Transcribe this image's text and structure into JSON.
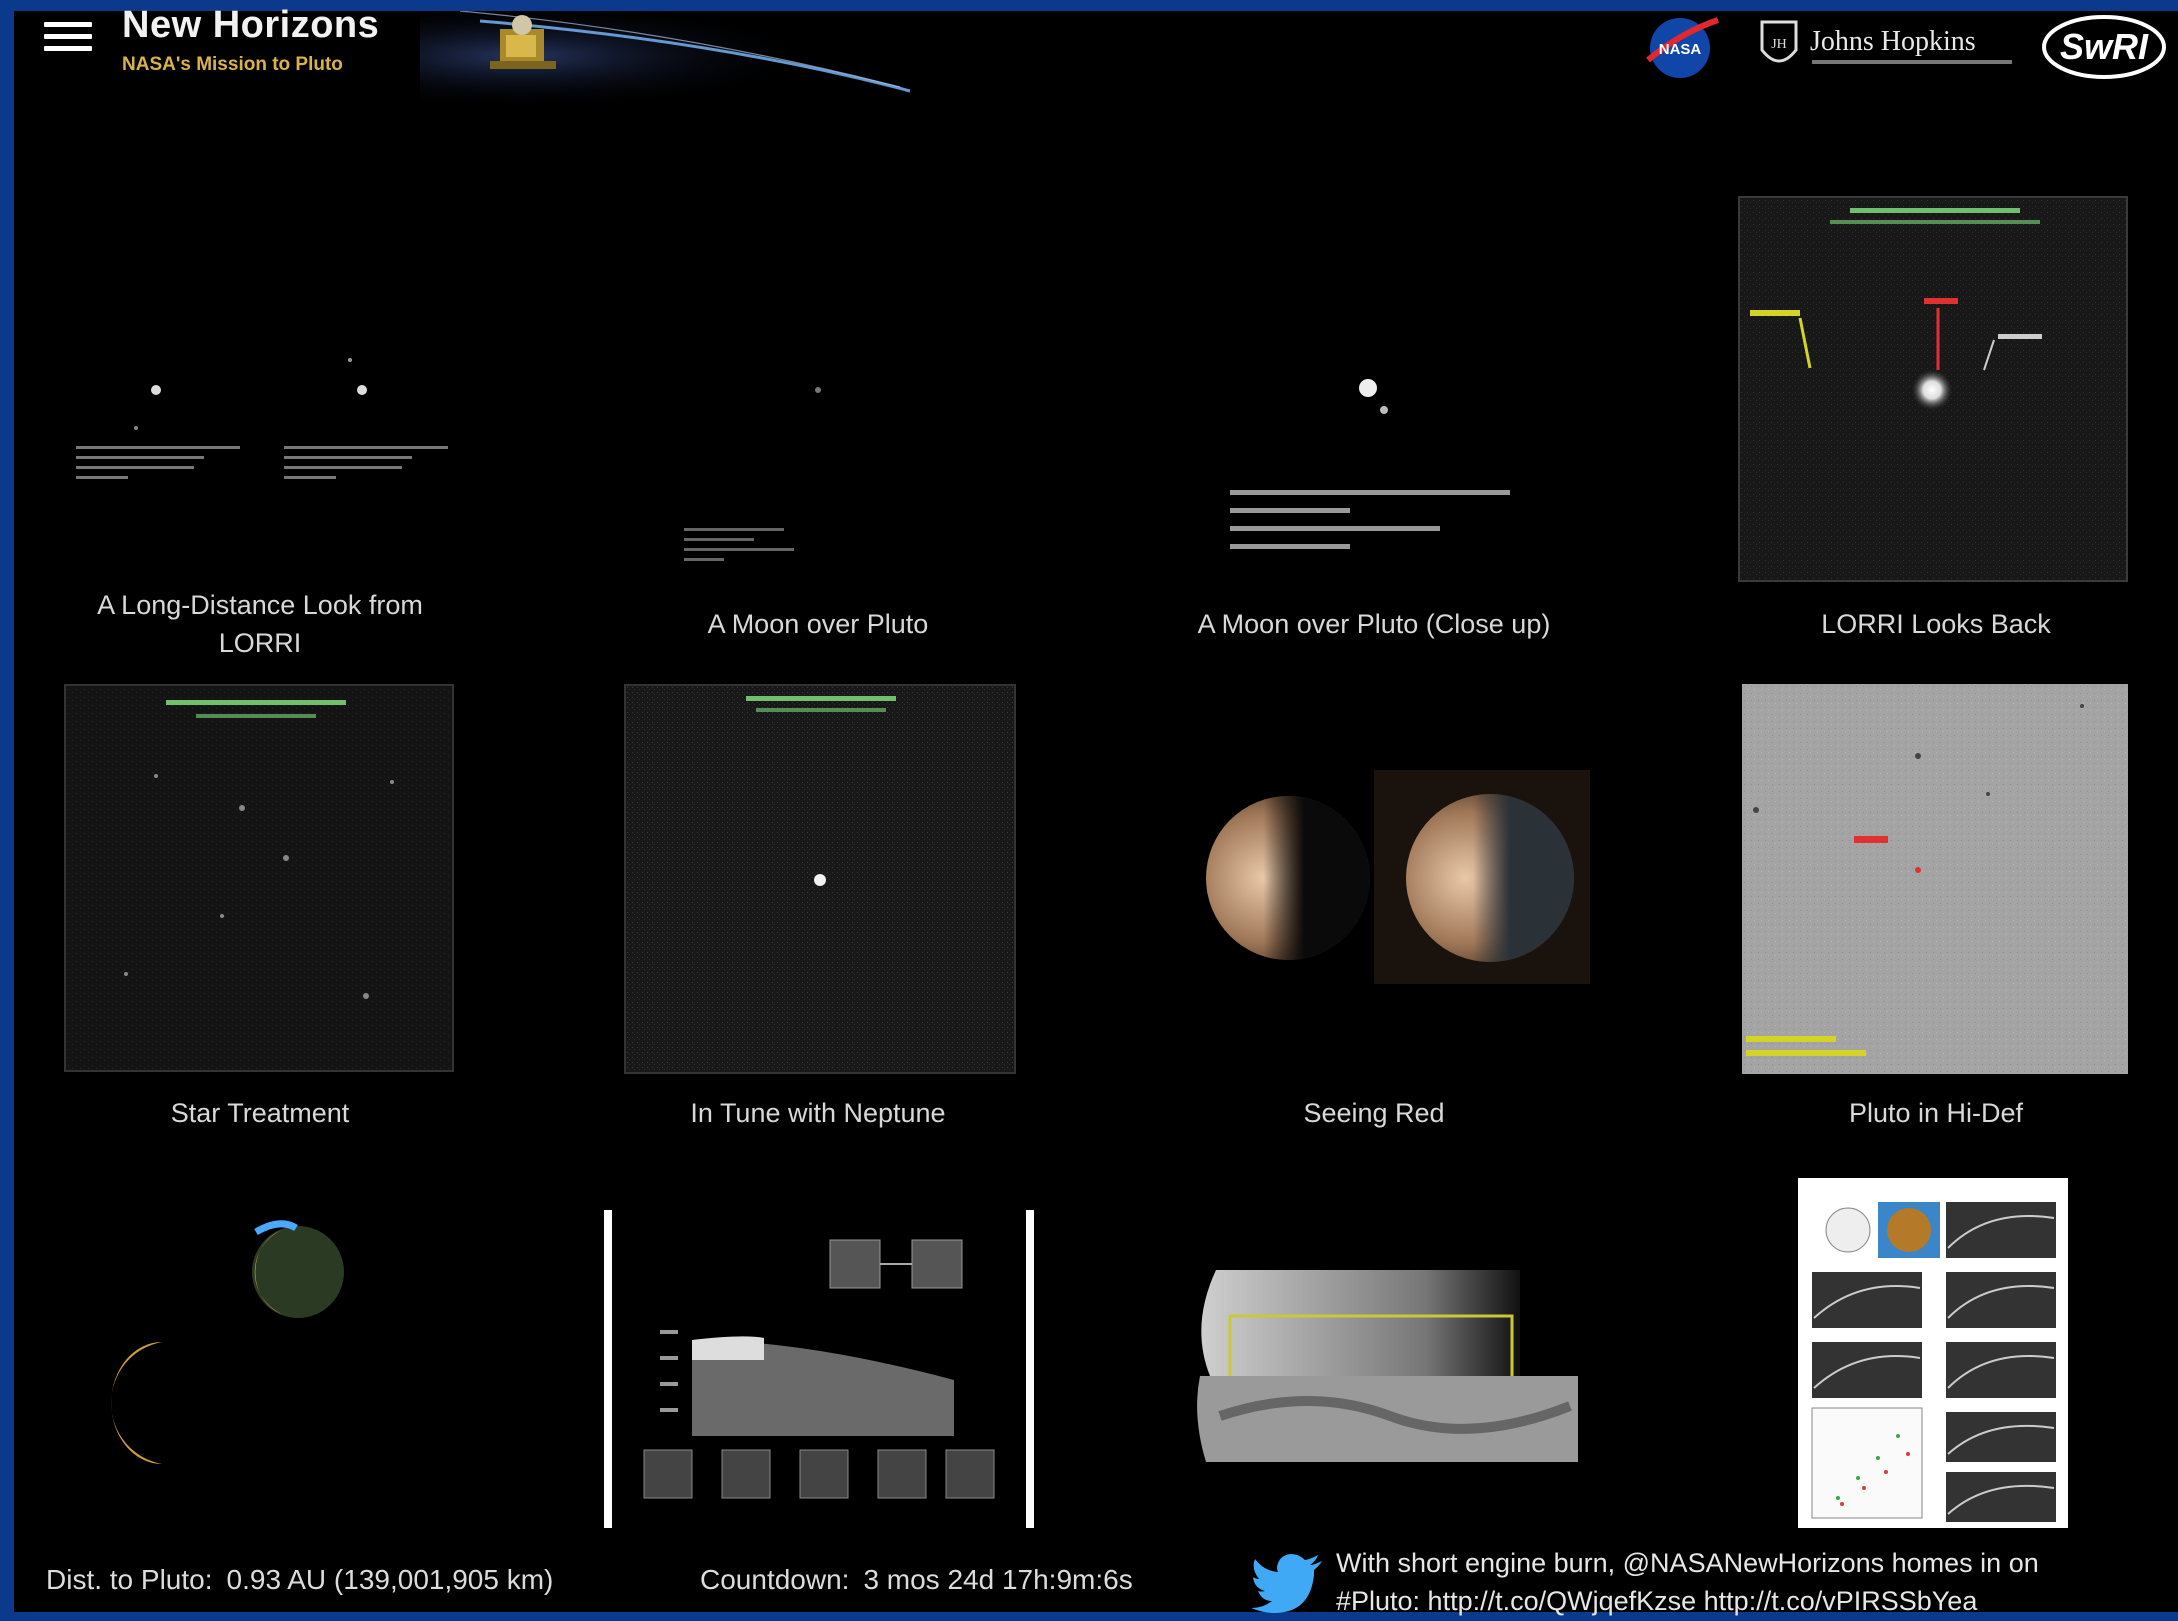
{
  "header": {
    "title": "New Horizons",
    "subtitle": "NASA's Mission to Pluto",
    "logos": [
      "NASA",
      "Johns Hopkins",
      "SwRI"
    ]
  },
  "gallery": {
    "items": [
      {
        "caption": "A Long-Distance Look from LORRI"
      },
      {
        "caption": "A Moon over Pluto"
      },
      {
        "caption": "A Moon over Pluto (Close up)"
      },
      {
        "caption": "LORRI Looks Back"
      },
      {
        "caption": "Star Treatment"
      },
      {
        "caption": "In Tune with Neptune"
      },
      {
        "caption": "Seeing Red"
      },
      {
        "caption": "Pluto in Hi-Def"
      },
      {
        "caption": ""
      },
      {
        "caption": ""
      },
      {
        "caption": ""
      },
      {
        "caption": ""
      }
    ]
  },
  "footer": {
    "distance_label": "Dist. to Pluto:",
    "distance_value": "0.93 AU (139,001,905 km)",
    "countdown_label": "Countdown:",
    "countdown_value": "3 mos 24d 17h:9m:6s",
    "tweet_line1": "With short engine burn, @NASANewHorizons homes in on",
    "tweet_line2": "#Pluto: http://t.co/QWjqefKzse http://t.co/vPIRSSbYea"
  },
  "colors": {
    "frame": "#0b3a8c",
    "subtitle": "#d9b24a",
    "background": "#000000",
    "twitter": "#3fa9f5"
  }
}
